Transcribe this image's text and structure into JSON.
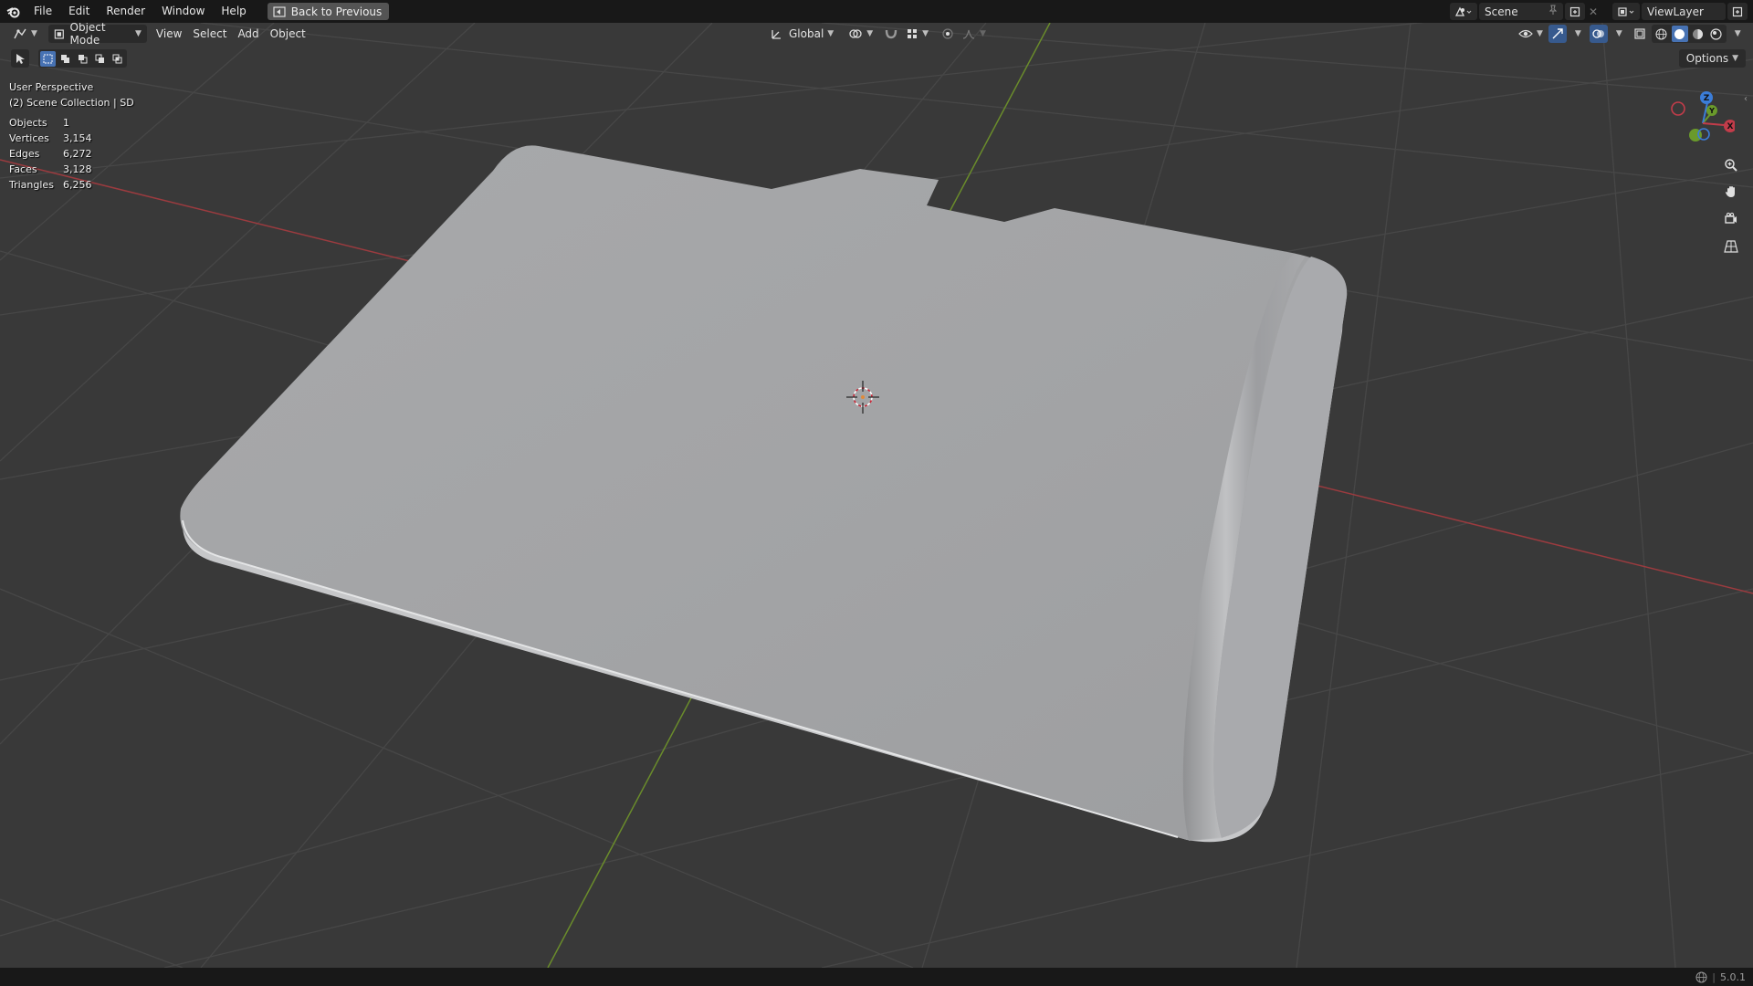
{
  "menubar": {
    "items": [
      "File",
      "Edit",
      "Render",
      "Window",
      "Help"
    ],
    "back_button": "Back to Previous",
    "scene": "Scene",
    "view_layer": "ViewLayer"
  },
  "viewport_header": {
    "mode": "Object Mode",
    "menus": [
      "View",
      "Select",
      "Add",
      "Object"
    ],
    "transform_orientation": "Global"
  },
  "overlay": {
    "perspective": "User Perspective",
    "collection": "(2) Scene Collection | SD",
    "stats": [
      {
        "label": "Objects",
        "value": "1"
      },
      {
        "label": "Vertices",
        "value": "3,154"
      },
      {
        "label": "Edges",
        "value": "6,272"
      },
      {
        "label": "Faces",
        "value": "3,128"
      },
      {
        "label": "Triangles",
        "value": "6,256"
      }
    ]
  },
  "options_label": "Options",
  "gizmo": {
    "z": "Z",
    "y": "Y",
    "x": "X"
  },
  "status": {
    "version": "5.0.1"
  },
  "colors": {
    "viewport_bg": "#393939",
    "grid": "#454545",
    "x_axis": "#9b3b3f",
    "y_axis": "#6a8c2b",
    "mesh": "#a4a5a7"
  }
}
